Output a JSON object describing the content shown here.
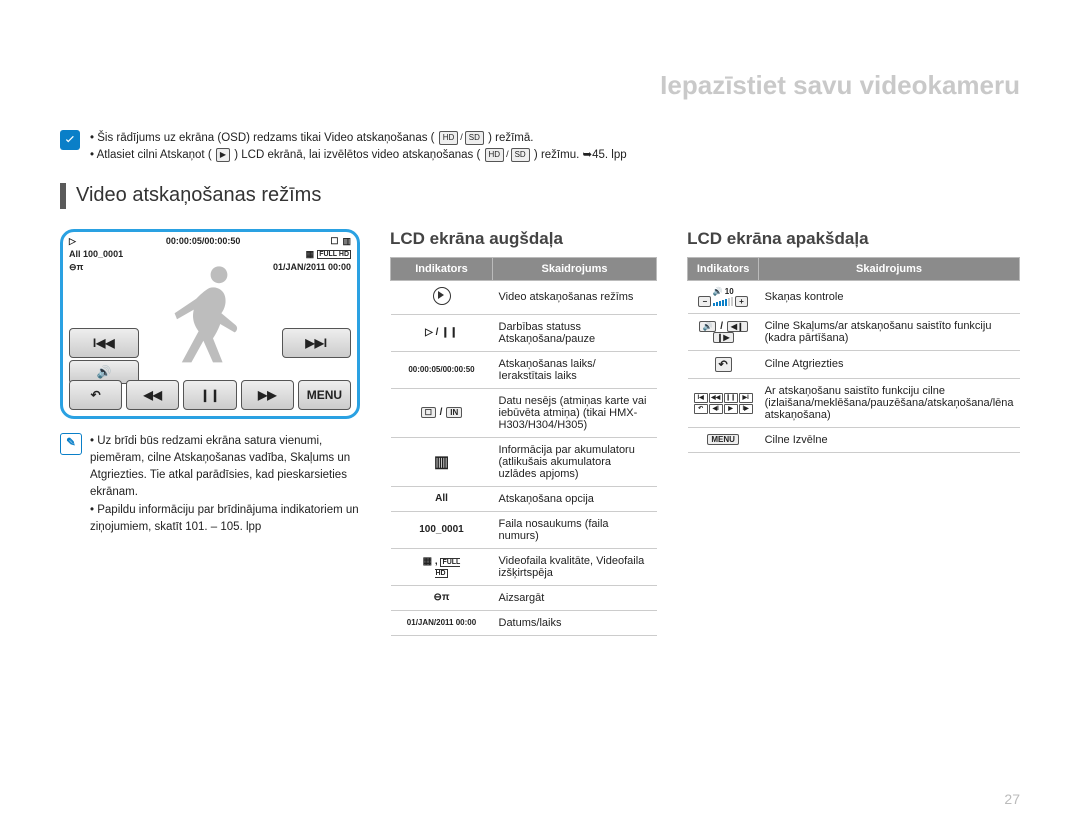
{
  "pageTitle": "Iepazīstiet savu videokameru",
  "pageNumber": "27",
  "topNote": {
    "line1_a": "Šis rādījums uz ekrāna (OSD) redzams tikai Video atskaņošanas (",
    "line1_b": ") režīmā.",
    "line2_a": "Atlasiet cilni Atskaņot (",
    "line2_b": ") LCD ekrānā, lai izvēlētos video atskaņošanas (",
    "line2_c": ") režīmu. ➥45. lpp"
  },
  "sectionTitle": "Video atskaņošanas režīms",
  "screen": {
    "time": "00:00:05/00:00:50",
    "filename": "100_0001",
    "datetime": "01/JAN/2011 00:00",
    "full": "FULL HD",
    "all": "All",
    "menu": "MENU"
  },
  "note2": {
    "p1": "Uz brīdi būs redzami ekrāna satura vienumi, piemēram, cilne Atskaņošanas vadība, Skaļums un Atgriezties. Tie atkal parādīsies, kad pieskarsieties ekrānam.",
    "p2": "Papildu informāciju par brīdinājuma indikatoriem un ziņojumiem, skatīt 101. – 105. lpp"
  },
  "midTable": {
    "title": "LCD ekrāna augšdaļa",
    "head_ind": "Indikators",
    "head_exp": "Skaidrojums",
    "rows": [
      {
        "icon": "play-mode-icon",
        "label": "",
        "text": "Video atskaņošanas režīms"
      },
      {
        "icon": "play-pause-icon",
        "label": "▷ / ❙❙",
        "text": "Darbības statuss Atskaņošana/pauze"
      },
      {
        "icon": "time-code-icon",
        "label": "00:00:05/00:00:50",
        "text": "Atskaņošanas laiks/ Ierakstītais laiks"
      },
      {
        "icon": "storage-icon",
        "label": "☐ / IN",
        "text": "Datu nesējs (atmiņas karte vai iebūvēta atmiņa) (tikai HMX-H303/H304/H305)"
      },
      {
        "icon": "battery-icon",
        "label": "▥",
        "text": "Informācija par akumulatoru (atlikušais akumulatora uzlādes apjoms)"
      },
      {
        "icon": "play-option-icon",
        "label": "All",
        "text": "Atskaņošana opcija"
      },
      {
        "icon": "filename-icon",
        "label": "100_0001",
        "text": "Faila nosaukums (faila numurs)"
      },
      {
        "icon": "quality-icon",
        "label": "▦ , FULL HD",
        "text": "Videofaila kvalitāte, Videofaila izšķirtspēja"
      },
      {
        "icon": "protect-icon",
        "label": "⊖π",
        "text": "Aizsargāt"
      },
      {
        "icon": "datetime-icon",
        "label": "01/JAN/2011 00:00",
        "text": "Datums/laiks"
      }
    ]
  },
  "rightTable": {
    "title": "LCD ekrāna apakšdaļa",
    "head_ind": "Indikators",
    "head_exp": "Skaidrojums",
    "rows": [
      {
        "icon": "volume-icon",
        "label": "vol",
        "text": "Skaņas kontrole"
      },
      {
        "icon": "vol-frame-tab-icon",
        "label": "volframe",
        "text": "Cilne Skaļums/ar atskaņošanu saistīto funkciju (kadra pārtīšana)"
      },
      {
        "icon": "return-icon",
        "label": "↶",
        "text": "Cilne Atgriezties"
      },
      {
        "icon": "playback-controls-icon",
        "label": "grid",
        "text": "Ar atskaņošanu saistīto funkciju cilne (izlaišana/meklēšana/pauzēšana/atskaņošana/lēna atskaņošana)"
      },
      {
        "icon": "menu-icon",
        "label": "MENU",
        "text": "Cilne Izvēlne"
      }
    ]
  }
}
